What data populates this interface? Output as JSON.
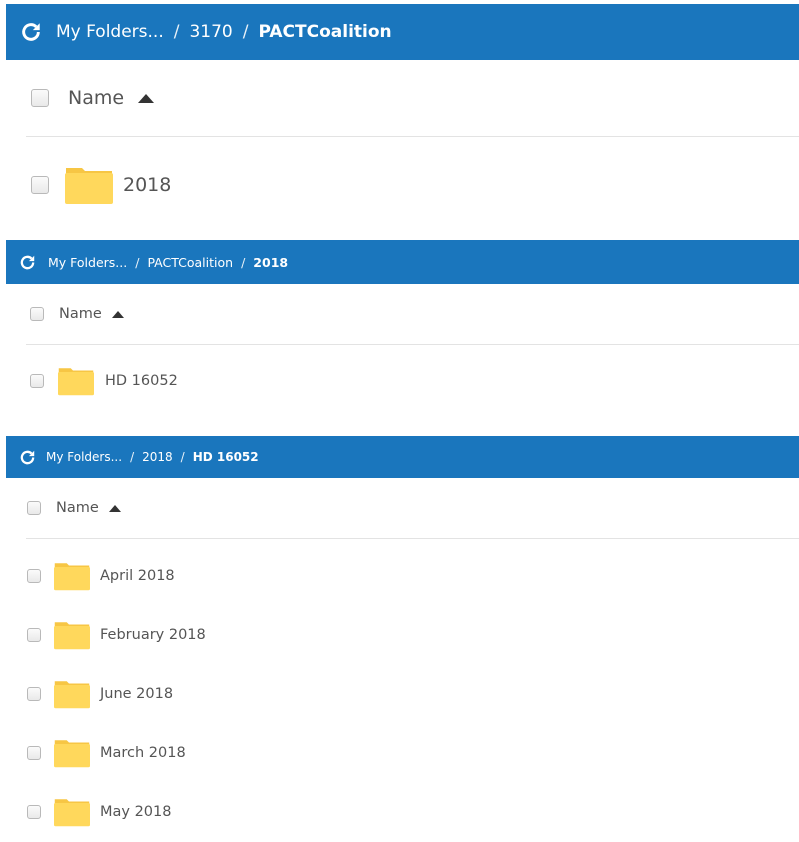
{
  "colors": {
    "bar_background": "#1a76bd",
    "bar_text": "#ffffff",
    "folder_yellow": "#ffd85c",
    "folder_tab": "#f7c644",
    "text": "#555555"
  },
  "icons": {
    "refresh": "refresh-icon",
    "folder": "folder-icon",
    "sort_ascending": "sort-ascending-icon"
  },
  "panels": [
    {
      "breadcrumb": [
        "My Folders...",
        "3170",
        "PACTCoalition"
      ],
      "separator": "/",
      "column_header": "Name",
      "items": [
        "2018"
      ]
    },
    {
      "breadcrumb": [
        "My Folders...",
        "PACTCoalition",
        "2018"
      ],
      "separator": "/",
      "column_header": "Name",
      "items": [
        "HD 16052"
      ]
    },
    {
      "breadcrumb": [
        "My Folders...",
        "2018",
        "HD 16052"
      ],
      "separator": "/",
      "column_header": "Name",
      "items": [
        "April 2018",
        "February 2018",
        "June 2018",
        "March 2018",
        "May 2018"
      ]
    }
  ]
}
